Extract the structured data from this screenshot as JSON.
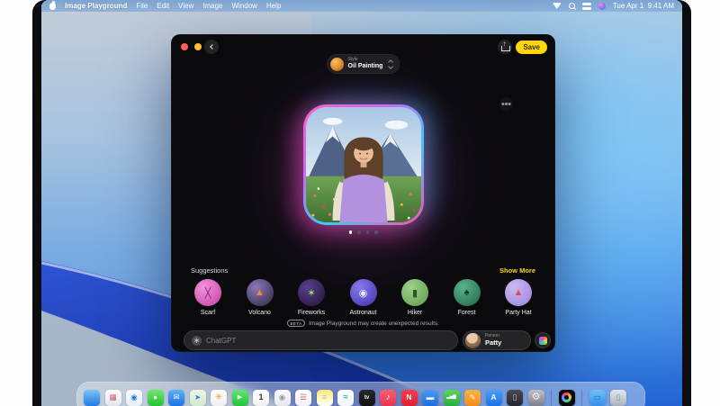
{
  "menubar": {
    "app_name": "Image Playground",
    "menus": [
      "File",
      "Edit",
      "View",
      "Image",
      "Window",
      "Help"
    ],
    "status_icons": [
      {
        "icon": "wifi-icon"
      },
      {
        "icon": "search-icon"
      },
      {
        "icon": "control-center-icon"
      },
      {
        "icon": "siri-icon"
      }
    ],
    "clock": "Tue Apr 1  9:41 AM"
  },
  "window": {
    "save_label": "Save",
    "style_chip": {
      "label": "Style",
      "value": "Oil Painting"
    },
    "carousel_dots": [
      true,
      false,
      false,
      false
    ],
    "suggestions": {
      "title": "Suggestions",
      "show_more": "Show More",
      "items": [
        {
          "name": "scarf",
          "label": "Scarf",
          "c1": "#f492dc",
          "c2": "#c23fa4",
          "glyph": "╳",
          "gc": "#8a1f6e"
        },
        {
          "name": "volcano",
          "label": "Volcano",
          "c1": "#8a78b8",
          "c2": "#30243e",
          "glyph": "▲",
          "gc": "#f08a3c"
        },
        {
          "name": "fireworks",
          "label": "Fireworks",
          "c1": "#5a3f8a",
          "c2": "#241438",
          "glyph": "✶",
          "gc": "#8af05a"
        },
        {
          "name": "astronaut",
          "label": "Astronaut",
          "c1": "#8a7af0",
          "c2": "#4030a8",
          "glyph": "◉",
          "gc": "#e8ecff"
        },
        {
          "name": "hiker",
          "label": "Hiker",
          "c1": "#9ecf8a",
          "c2": "#5e9e48",
          "glyph": "▮",
          "gc": "#2e5724"
        },
        {
          "name": "forest",
          "label": "Forest",
          "c1": "#5ab388",
          "c2": "#1f6448",
          "glyph": "♠",
          "gc": "#0c3b28"
        },
        {
          "name": "party-hat",
          "label": "Party Hat",
          "c1": "#cbb9f2",
          "c2": "#9a82dd",
          "glyph": "▲",
          "gc": "#e04848"
        }
      ]
    },
    "beta_badge": "BETA",
    "disclaimer": "Image Playground may create unexpected results.",
    "prompt": {
      "placeholder": "ChatGPT",
      "icon_glyph": "∗"
    },
    "person_chip": {
      "label": "Person",
      "value": "Patty"
    }
  },
  "dock": {
    "items": [
      {
        "name": "finder",
        "c1": "#7ec3f5",
        "c2": "#1f7ae8",
        "glyph": "",
        "gc": "#ffffff"
      },
      {
        "name": "launchpad",
        "c1": "#fdfdfd",
        "c2": "#e2e6ea",
        "glyph": "▦",
        "gc": "#d05a6e"
      },
      {
        "name": "safari",
        "c1": "#f8fafc",
        "c2": "#e8eef5",
        "glyph": "◉",
        "gc": "#1f7ae8"
      },
      {
        "name": "messages",
        "c1": "#6ee86e",
        "c2": "#24c232",
        "glyph": "●",
        "gc": "#ffffff"
      },
      {
        "name": "mail",
        "c1": "#5fb0f8",
        "c2": "#1a72e8",
        "glyph": "✉",
        "gc": "#ffffff"
      },
      {
        "name": "maps",
        "c1": "#f0f5e8",
        "c2": "#cfe8d0",
        "glyph": "➤",
        "gc": "#2a7ae0"
      },
      {
        "name": "photos",
        "c1": "#ffffff",
        "c2": "#efefef",
        "glyph": "✳",
        "gc": "#f09a3c",
        "gs": 10
      },
      {
        "name": "facetime",
        "c1": "#5ee86e",
        "c2": "#22c238",
        "glyph": "▶",
        "gc": "#ffffff",
        "gs": 7
      },
      {
        "name": "calendar",
        "c1": "#ffffff",
        "c2": "#f2f2f4",
        "glyph": "1",
        "gc": "#333333",
        "gs": 9
      },
      {
        "name": "contacts",
        "c1": "#fbfbfd",
        "c2": "#e8e8ec",
        "glyph": "◉",
        "gc": "#9a9aa2"
      },
      {
        "name": "reminders",
        "c1": "#ffffff",
        "c2": "#f2f2f6",
        "glyph": "☰",
        "gc": "#e05a5a"
      },
      {
        "name": "notes",
        "c1": "#ffe873",
        "c2": "#ffffff",
        "glyph": "≡",
        "gc": "#b8b8bc"
      },
      {
        "name": "freeform",
        "c1": "#ffffff",
        "c2": "#f2f4f8",
        "glyph": "≈",
        "gc": "#28b2e8",
        "gs": 10
      },
      {
        "name": "apple-tv",
        "c1": "#2a2a2e",
        "c2": "#111114",
        "glyph": "tv",
        "gc": "#ffffff",
        "gs": 6
      },
      {
        "name": "music",
        "c1": "#fc5c72",
        "c2": "#e8344e",
        "glyph": "♪",
        "gc": "#ffffff",
        "gs": 10
      },
      {
        "name": "news",
        "c1": "#fc3b4e",
        "c2": "#e0202e",
        "glyph": "N",
        "gc": "#ffffff"
      },
      {
        "name": "keynote",
        "c1": "#4a9af5",
        "c2": "#1a6ee0",
        "glyph": "▬",
        "gc": "#ffffff"
      },
      {
        "name": "numbers",
        "c1": "#5ed45e",
        "c2": "#22b03a",
        "glyph": "▃▅▇",
        "gc": "#ffffff",
        "gs": 4.5
      },
      {
        "name": "pages",
        "c1": "#ffb340",
        "c2": "#f08c1a",
        "glyph": "✎",
        "gc": "#ffffff"
      },
      {
        "name": "app-store",
        "c1": "#4aa0f8",
        "c2": "#1a70e8",
        "glyph": "A",
        "gc": "#ffffff"
      },
      {
        "name": "iphone-mirroring",
        "c1": "#4a4a52",
        "c2": "#26262c",
        "glyph": "▯",
        "gc": "#cfcfd4"
      },
      {
        "name": "system-settings",
        "c1": "#c2c2c8",
        "c2": "#7e7e86",
        "glyph": "⚙",
        "gc": "#f2f2f4",
        "gs": 11
      },
      {
        "type": "separator"
      },
      {
        "name": "image-playground",
        "type": "ring"
      },
      {
        "type": "separator"
      },
      {
        "name": "downloads-folder",
        "c1": "#6ec0f5",
        "c2": "#3390e8",
        "glyph": "▭",
        "gc": "#2a70b8"
      },
      {
        "name": "trash",
        "c1": "#e4e8ee",
        "c2": "#aab2bc",
        "glyph": "▯",
        "gc": "#808894"
      }
    ]
  },
  "colors": {
    "accent_yellow": "#FFD60A",
    "window_bg": "#0A0A0C",
    "menubar_tint": "#84ACD8"
  }
}
